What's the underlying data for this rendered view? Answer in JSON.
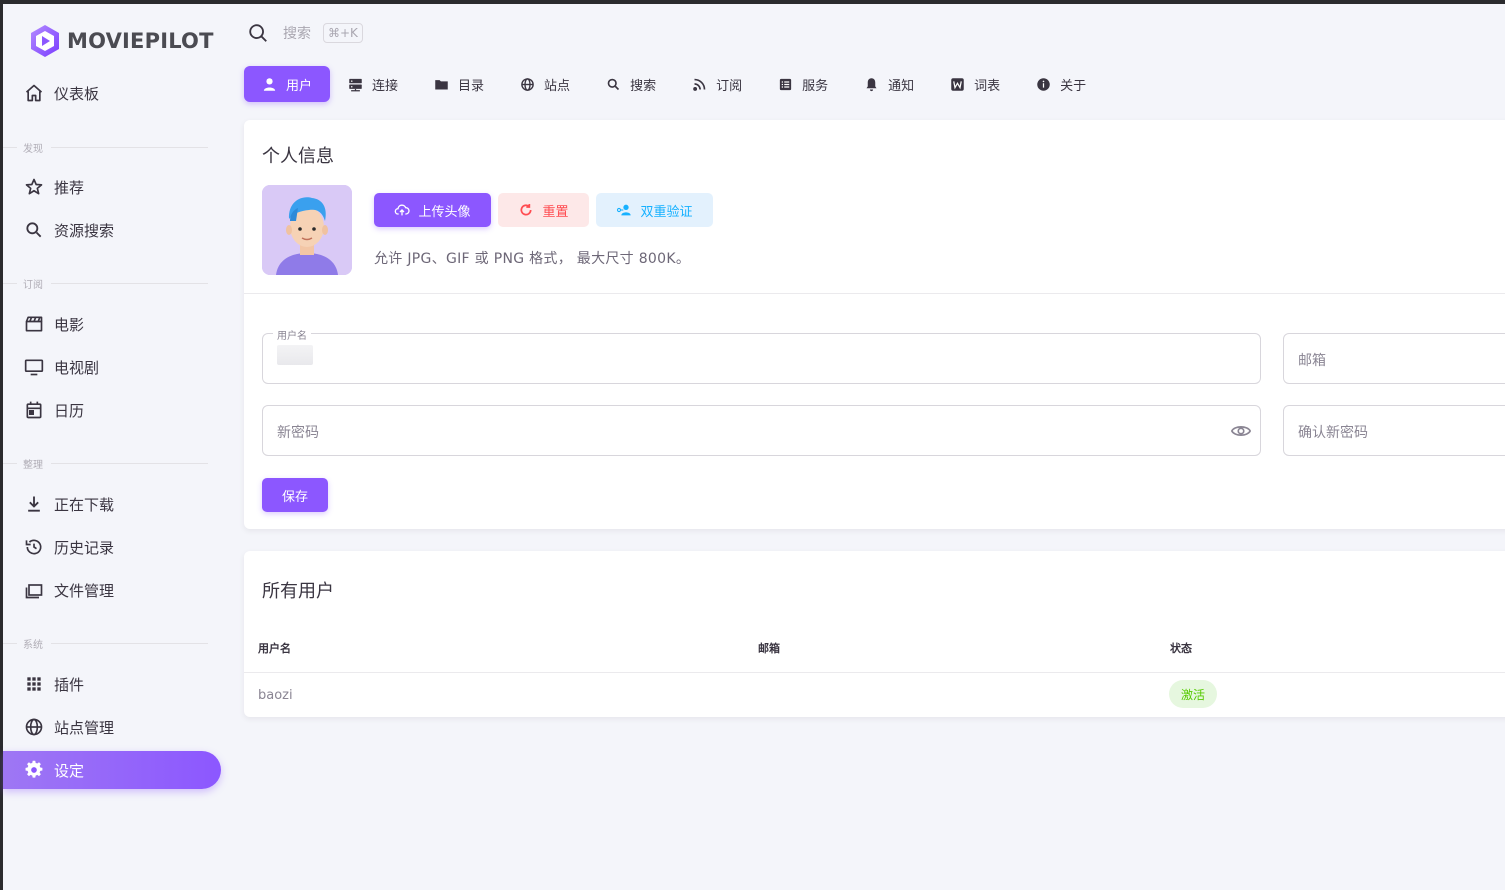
{
  "brand": {
    "name": "MOVIEPILOT"
  },
  "sidebar": {
    "dashboard": "仪表板",
    "sections": {
      "discover": "发现",
      "subscribe": "订阅",
      "organize": "整理",
      "system": "系统"
    },
    "items": {
      "recommend": "推荐",
      "resource_search": "资源搜索",
      "movie": "电影",
      "tv": "电视剧",
      "calendar": "日历",
      "downloading": "正在下载",
      "history": "历史记录",
      "file_manager": "文件管理",
      "plugins": "插件",
      "site_manager": "站点管理",
      "settings": "设定"
    }
  },
  "header": {
    "search_placeholder": "搜索",
    "search_shortcut": "⌘+K"
  },
  "tabs": {
    "user": "用户",
    "connect": "连接",
    "directory": "目录",
    "site": "站点",
    "search": "搜索",
    "subscribe": "订阅",
    "service": "服务",
    "notify": "通知",
    "words": "词表",
    "about": "关于",
    "active": "user"
  },
  "profile": {
    "title": "个人信息",
    "upload_label": "上传头像",
    "reset_label": "重置",
    "twofa_label": "双重验证",
    "hint": "允许 JPG、GIF 或 PNG 格式， 最大尺寸 800K。",
    "username_label": "用户名",
    "email_placeholder": "邮箱",
    "new_password_placeholder": "新密码",
    "confirm_password_placeholder": "确认新密码",
    "save_label": "保存"
  },
  "users": {
    "title": "所有用户",
    "columns": [
      "用户名",
      "邮箱",
      "状态"
    ],
    "rows": [
      {
        "username": "baozi",
        "email": "",
        "status": "激活"
      }
    ]
  },
  "colors": {
    "accent": "#8c57ff",
    "error": "#ff4c51",
    "info": "#16b1ff",
    "success": "#56ca00"
  }
}
